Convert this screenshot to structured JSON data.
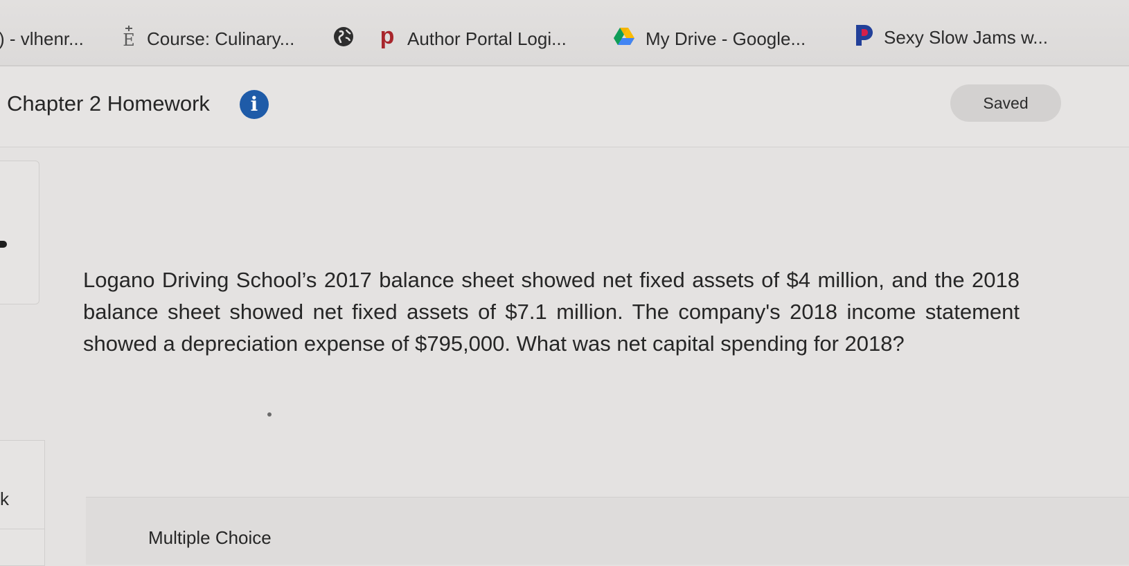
{
  "bookmarks": [
    {
      "label": ") - vlhenr...",
      "icon": "none"
    },
    {
      "label": "Course: Culinary...",
      "icon": "e-serif-logo-icon"
    },
    {
      "label": "",
      "icon": "globe-icon"
    },
    {
      "label": "Author Portal Logi...",
      "icon": "p-logo-icon"
    },
    {
      "label": "My Drive - Google...",
      "icon": "google-drive-icon"
    },
    {
      "label": "Sexy Slow Jams w...",
      "icon": "pandora-icon"
    }
  ],
  "header": {
    "title": "Chapter 2 Homework",
    "info_icon_glyph": "i",
    "status": "Saved"
  },
  "sidebar": {
    "fragment_text": "k"
  },
  "question": {
    "text": "Logano Driving School’s 2017 balance sheet showed net fixed assets of $4 million, and the 2018 balance sheet showed net fixed assets of $7.1 million. The company's 2018 income statement showed a depreciation expense of $795,000. What was net capital spending for 2018?"
  },
  "answer": {
    "type_label": "Multiple Choice"
  },
  "colors": {
    "accent_blue": "#1e5ba8",
    "p_logo_red": "#a8262c",
    "pandora_blue": "#224099",
    "pandora_red": "#d6204a"
  }
}
